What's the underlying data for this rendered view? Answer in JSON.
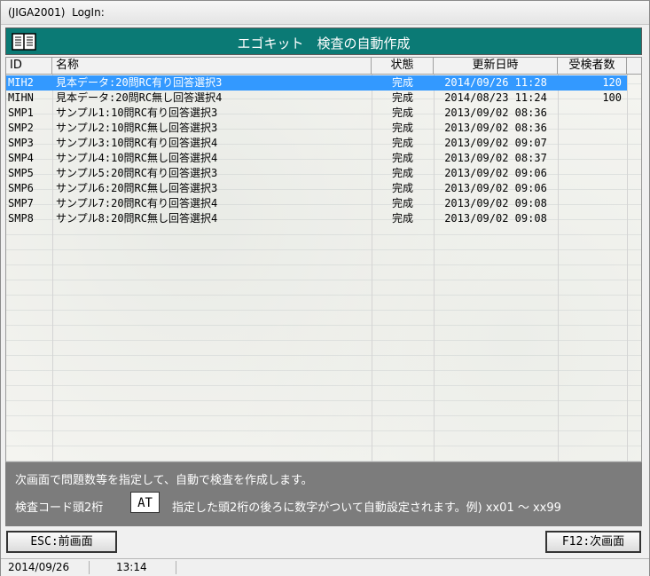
{
  "window": {
    "title": "(JIGA2001)  LogIn:"
  },
  "banner": {
    "title": "エゴキット　検査の自動作成",
    "icon": "book-icon",
    "color": "#0b7a75"
  },
  "table": {
    "columns": [
      "ID",
      "名称",
      "状態",
      "更新日時",
      "受検者数"
    ],
    "rows": [
      {
        "id": "MIH2",
        "name": "見本データ:20問RC有り回答選択3",
        "status": "完成",
        "updated": "2014/09/26 11:28",
        "count": "120",
        "selected": true
      },
      {
        "id": "MIHN",
        "name": "見本データ:20問RC無し回答選択4",
        "status": "完成",
        "updated": "2014/08/23 11:24",
        "count": "100"
      },
      {
        "id": "SMP1",
        "name": "サンプル1:10問RC有り回答選択3",
        "status": "完成",
        "updated": "2013/09/02 08:36",
        "count": ""
      },
      {
        "id": "SMP2",
        "name": "サンプル2:10問RC無し回答選択3",
        "status": "完成",
        "updated": "2013/09/02 08:36",
        "count": ""
      },
      {
        "id": "SMP3",
        "name": "サンプル3:10問RC有り回答選択4",
        "status": "完成",
        "updated": "2013/09/02 09:07",
        "count": ""
      },
      {
        "id": "SMP4",
        "name": "サンプル4:10問RC無し回答選択4",
        "status": "完成",
        "updated": "2013/09/02 08:37",
        "count": ""
      },
      {
        "id": "SMP5",
        "name": "サンプル5:20問RC有り回答選択3",
        "status": "完成",
        "updated": "2013/09/02 09:06",
        "count": ""
      },
      {
        "id": "SMP6",
        "name": "サンプル6:20問RC無し回答選択3",
        "status": "完成",
        "updated": "2013/09/02 09:06",
        "count": ""
      },
      {
        "id": "SMP7",
        "name": "サンプル7:20問RC有り回答選択4",
        "status": "完成",
        "updated": "2013/09/02 09:08",
        "count": ""
      },
      {
        "id": "SMP8",
        "name": "サンプル8:20問RC無し回答選択4",
        "status": "完成",
        "updated": "2013/09/02 09:08",
        "count": ""
      }
    ],
    "selected_color": "#3399ff"
  },
  "info": {
    "line1": "次画面で問題数等を指定して、自動で検査を作成します。",
    "code_label": "検査コード頭2桁",
    "code_value": "AT",
    "code_hint": "指定した頭2桁の後ろに数字がついて自動設定されます。例) xx01 ～ xx99"
  },
  "buttons": {
    "prev": "ESC:前画面",
    "next": "F12:次画面"
  },
  "status": {
    "date": "2014/09/26",
    "time": "13:14"
  }
}
